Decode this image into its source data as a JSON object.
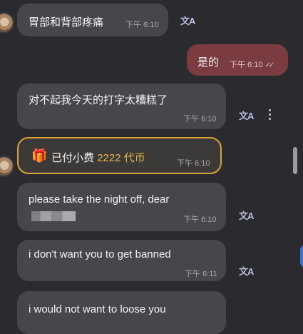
{
  "messages": [
    {
      "text": "胃部和背部疼痛",
      "time": "下午 6:10",
      "translate_icon": "translate-icon"
    },
    {
      "text": "是的",
      "time": "下午 6:10",
      "read": "✓✓"
    },
    {
      "text": "对不起我今天的打字太糟糕了",
      "time": "下午 6:10",
      "translate_icon": "translate-icon"
    },
    {
      "tip_label": "已付小费",
      "tip_amount": "2222 代币",
      "time": "下午 6:10",
      "gift_icon": "gift-icon"
    },
    {
      "text": "please take the night off, dear",
      "time": "下午 6:10",
      "translate_icon": "translate-icon"
    },
    {
      "text": "i don't want you to get banned",
      "time": "下午 6:11",
      "translate_icon": "translate-icon"
    },
    {
      "text": "i would not want to loose you"
    }
  ],
  "icons": {
    "translate": "文A",
    "more": "more-vertical-icon"
  },
  "colors": {
    "background": "#2b2b2f",
    "bubble": "#46474c",
    "own_bubble": "#7a3b41",
    "tip_border": "#d9a33a",
    "tip_amount": "#e8b54a"
  }
}
